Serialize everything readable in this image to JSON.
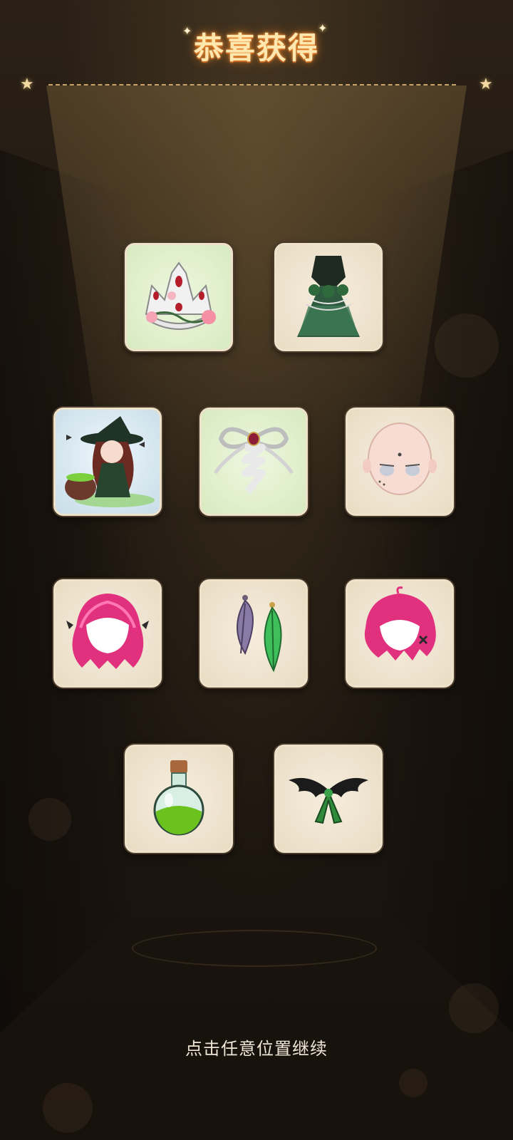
{
  "title": "恭喜获得",
  "continue_hint": "点击任意位置继续",
  "rewards": [
    {
      "icon": "crown-icon",
      "background": "green"
    },
    {
      "icon": "green-gown-icon",
      "background": "beige"
    },
    {
      "icon": "witch-character-icon",
      "background": "blue"
    },
    {
      "icon": "white-ribbon-bow-icon",
      "background": "green"
    },
    {
      "icon": "face-icon",
      "background": "beige"
    },
    {
      "icon": "pink-hair-icon",
      "background": "beige"
    },
    {
      "icon": "feather-earrings-icon",
      "background": "beige"
    },
    {
      "icon": "pink-short-hair-icon",
      "background": "beige"
    },
    {
      "icon": "potion-bottle-icon",
      "background": "beige"
    },
    {
      "icon": "black-wings-ribbon-icon",
      "background": "beige"
    }
  ],
  "colors": {
    "title_glow": "#ff9c3a",
    "card_border": "#efe2cb",
    "divider": "#c9a46a"
  }
}
